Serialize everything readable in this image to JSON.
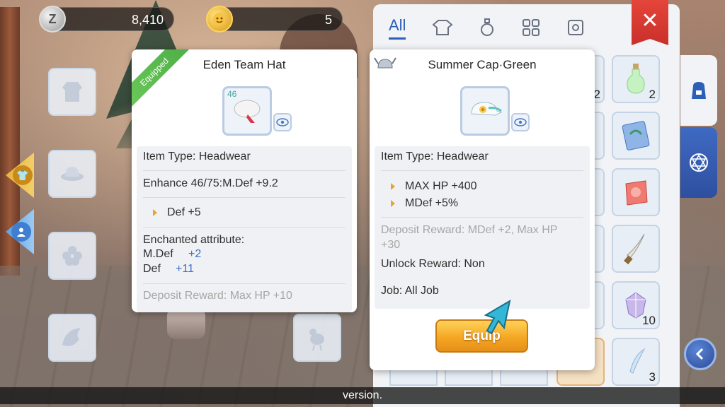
{
  "currency": {
    "zeny": "8,410",
    "zeny_icon_letter": "Z",
    "bcoin": "5"
  },
  "bag": {
    "tabs": [
      {
        "label": "All",
        "icon": "all-tab",
        "active": true
      },
      {
        "label": "",
        "icon": "shirt-icon"
      },
      {
        "label": "",
        "icon": "potion-icon"
      },
      {
        "label": "",
        "icon": "grid-icon"
      },
      {
        "label": "",
        "icon": "card-icon"
      }
    ],
    "items": [
      {
        "count": "2"
      },
      {
        "count": "2"
      },
      {
        "count": ""
      },
      {
        "count": ""
      },
      {
        "count": ""
      },
      {
        "count": "10"
      },
      {
        "count": "3"
      }
    ]
  },
  "tooltip_equipped": {
    "badge": "Equipped",
    "title": "Eden Team Hat",
    "level": "46",
    "item_type": "Item Type: Headwear",
    "enhance": "Enhance 46/75:M.Def +9.2",
    "stat1": "Def +5",
    "enchanted_label": "Enchanted attribute:",
    "ench": [
      {
        "name": "M.Def",
        "value": "+2"
      },
      {
        "name": "Def",
        "value": "+11"
      }
    ],
    "deposit": "Deposit Reward: Max HP +10"
  },
  "tooltip_compare": {
    "title": "Summer Cap·Green",
    "item_type": "Item Type: Headwear",
    "stat1": "MAX HP +400",
    "stat2": "MDef +5%",
    "deposit_line1": "Deposit Reward: MDef +2, Max HP",
    "deposit_line2": "+30",
    "unlock": "Unlock Reward: Non",
    "job": "Job: All Job",
    "equip_label": "Equip"
  },
  "caption": "version.",
  "colors": {
    "accent": "#2c5fb8",
    "equip_button": "#f5a623",
    "close_button": "#d8382f",
    "equipped_badge": "#5bbd4e"
  }
}
